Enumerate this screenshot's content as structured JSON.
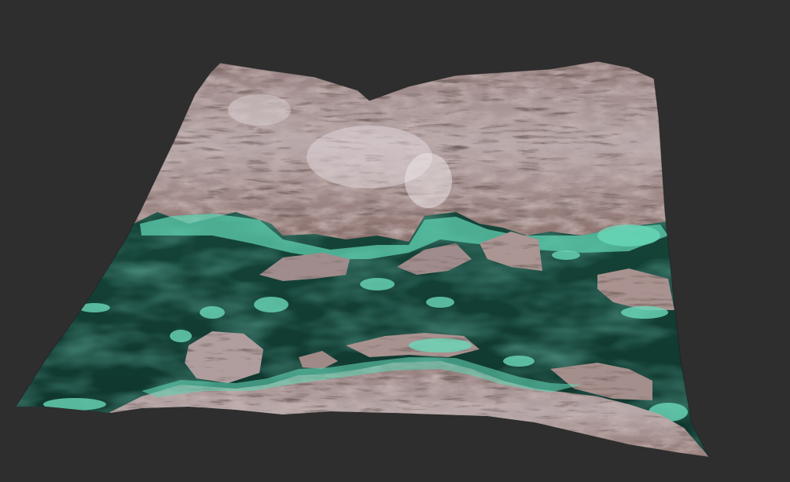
{
  "viewport": {
    "background_color": "#2e2e2e"
  },
  "terrain": {
    "kind": "3d-terrain-heightmap",
    "colors": {
      "rock_light": "#d8d0d2",
      "rock_mid": "#9a7f7c",
      "rock_dark": "#4a3a38",
      "rock_rust": "#8a5a4e",
      "water_deep": "#0f3a30",
      "water_mid": "#1d5a4a",
      "water_shallow": "#6fd6b8",
      "foam": "#a9f0dc"
    }
  }
}
